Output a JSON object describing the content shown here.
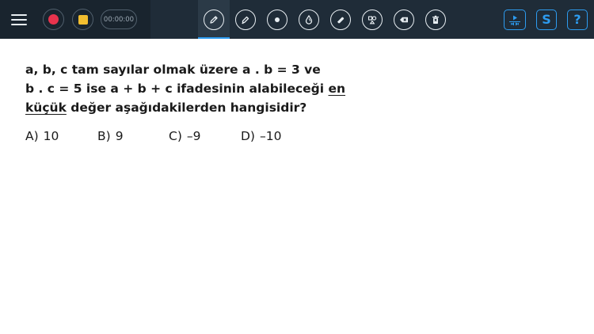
{
  "toolbar": {
    "timer": "00:00:00",
    "colors": {
      "background": "#1f2c38",
      "left_panel": "#19242e",
      "record": "#e8334d",
      "stop": "#f2be2f",
      "accent": "#2d9cf0"
    },
    "tools": [
      {
        "icon": "pencil-icon",
        "active": true
      },
      {
        "icon": "marker-icon",
        "active": false
      },
      {
        "icon": "dot-icon",
        "active": false
      },
      {
        "icon": "ink-drop-icon",
        "active": false
      },
      {
        "icon": "eraser-icon",
        "active": false
      },
      {
        "icon": "shapes-icon",
        "active": false
      },
      {
        "icon": "backspace-icon",
        "active": false
      },
      {
        "icon": "trash-icon",
        "active": false
      }
    ],
    "right": {
      "media_icon": "media-player-icon",
      "s_label": "S",
      "help_label": "?"
    }
  },
  "question": {
    "line1": "a, b, c tam sayılar olmak üzere a . b = 3 ve",
    "line2_pre": "b . c = 5 ise a + b + c ifadesinin alabileceği ",
    "underline1": "en",
    "underline2": "küçük",
    "line3_post": " değer aşağıdakilerden hangisidir?"
  },
  "options": [
    {
      "letter": "A)",
      "value": "10"
    },
    {
      "letter": "B)",
      "value": "9"
    },
    {
      "letter": "C)",
      "value": "–9"
    },
    {
      "letter": "D)",
      "value": "–10"
    }
  ]
}
